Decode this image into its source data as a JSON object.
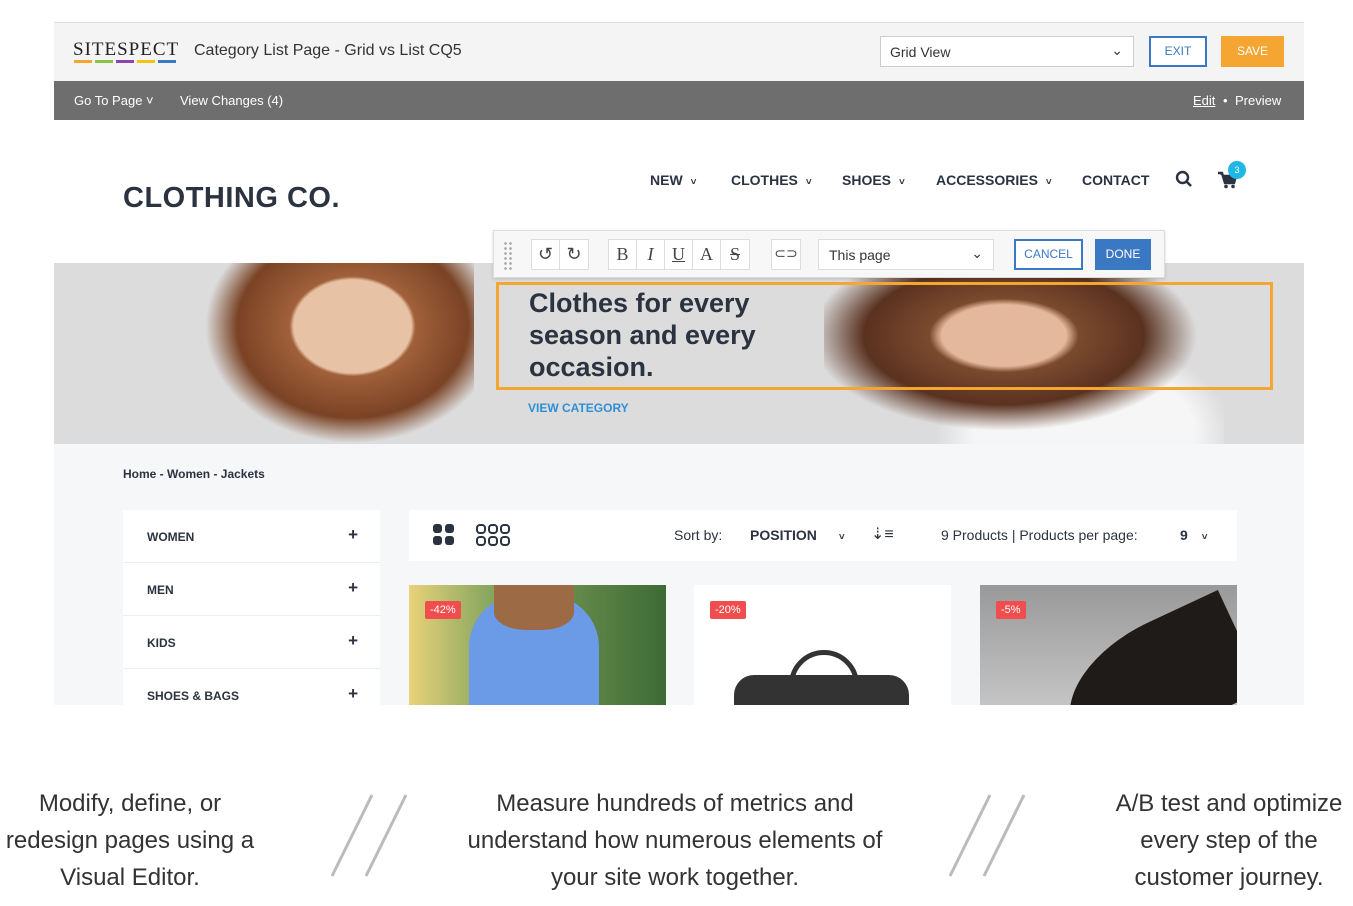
{
  "editor": {
    "logo_text": "SiteSpect",
    "logo_colors": [
      "#f5a531",
      "#8bc34a",
      "#8e44ad",
      "#f1c40f",
      "#3b78c3"
    ],
    "page_title": "Category List Page - Grid vs List CQ5",
    "view_select": "Grid View",
    "exit_label": "EXIT",
    "save_label": "SAVE",
    "go_to_page": "Go To Page",
    "view_changes": "View Changes (4)",
    "edit_label": "Edit",
    "preview_label": "Preview",
    "accent": "#3b78c3",
    "save_color": "#f5a531"
  },
  "site": {
    "brand": "CLOTHING CO.",
    "nav": [
      "NEW",
      "CLOTHES",
      "SHOES",
      "ACCESSORIES",
      "CONTACT"
    ],
    "cart_count": "3",
    "hero_heading": "Clothes for every season and every occasion.",
    "hero_link": "VIEW CATEGORY",
    "breadcrumb": "Home - Women - Jackets",
    "sidebar": [
      {
        "label": "WOMEN"
      },
      {
        "label": "MEN"
      },
      {
        "label": "KIDS"
      },
      {
        "label": "SHOES & BAGS"
      }
    ],
    "sort_label": "Sort by:",
    "sort_value": "POSITION",
    "products_text": "9 Products | Products per page:",
    "per_page": "9",
    "products": [
      {
        "discount": "-42%"
      },
      {
        "discount": "-20%"
      },
      {
        "discount": "-5%"
      }
    ]
  },
  "toolbar": {
    "scope_select": "This page",
    "cancel_label": "CANCEL",
    "done_label": "DONE",
    "format_buttons": [
      "B",
      "I",
      "U",
      "A",
      "S"
    ]
  },
  "captions": [
    "Modify, define, or redesign pages using a Visual Editor.",
    "Measure hundreds of metrics and understand how numerous elements of your site work together.",
    "A/B test and optimize every step of the customer journey."
  ]
}
